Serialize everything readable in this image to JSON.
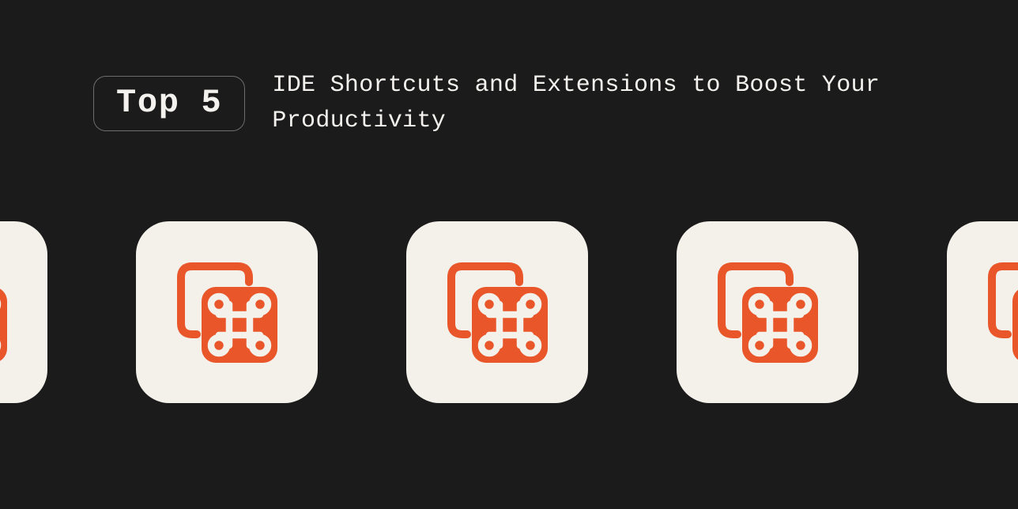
{
  "badge_label": "Top 5",
  "title": "IDE Shortcuts and Extensions to Boost Your Productivity",
  "colors": {
    "background": "#1b1b1b",
    "text": "#f4f2ee",
    "badge_border": "#6d6d6d",
    "card_bg": "#f4f1eb",
    "accent_orange": "#e8562a"
  },
  "card_count": 5,
  "icon_name": "command-copy-icon"
}
